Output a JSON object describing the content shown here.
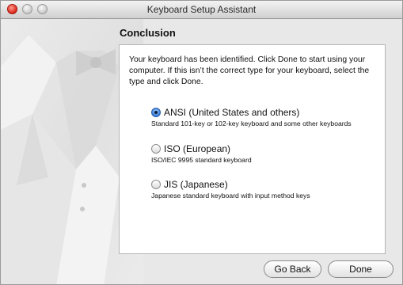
{
  "window": {
    "title": "Keyboard Setup Assistant"
  },
  "section": {
    "title": "Conclusion"
  },
  "intro": "Your keyboard has been identified. Click Done to start using your computer. If this isn’t the correct type for your keyboard, select the type and click Done.",
  "options": [
    {
      "label": "ANSI (United States and others)",
      "description": "Standard 101-key or 102-key keyboard and some other keyboards",
      "selected": true
    },
    {
      "label": "ISO (European)",
      "description": "ISO/IEC 9995 standard keyboard",
      "selected": false
    },
    {
      "label": "JIS (Japanese)",
      "description": "Japanese standard keyboard with input method keys",
      "selected": false
    }
  ],
  "buttons": {
    "back": "Go Back",
    "done": "Done"
  }
}
